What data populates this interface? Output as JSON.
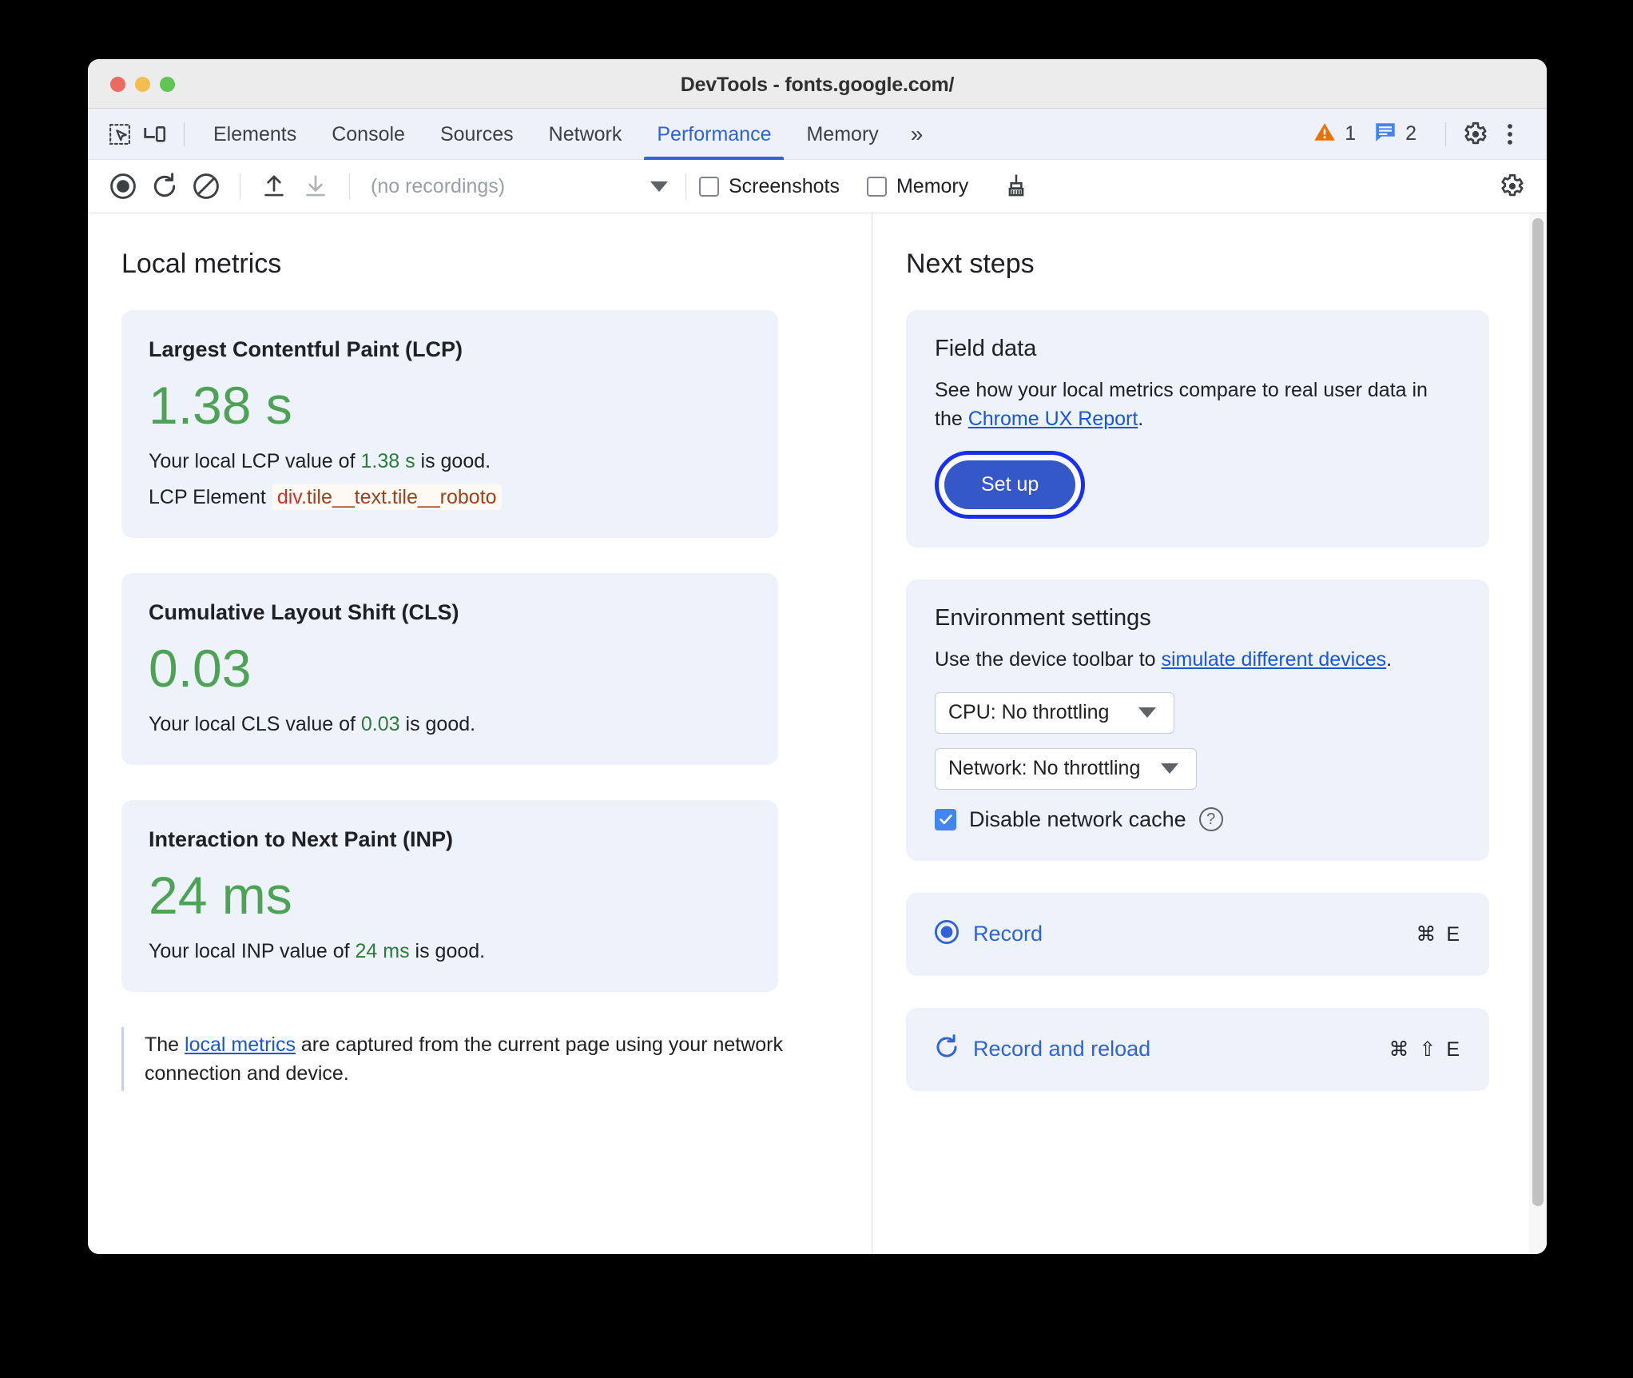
{
  "window": {
    "title": "DevTools - fonts.google.com/",
    "traffic_lights": [
      "close",
      "minimize",
      "maximize"
    ]
  },
  "tabbar": {
    "inspect_icon": "inspect-element-icon",
    "device_icon": "device-toolbar-icon",
    "tabs": [
      {
        "label": "Elements",
        "active": false
      },
      {
        "label": "Console",
        "active": false
      },
      {
        "label": "Sources",
        "active": false
      },
      {
        "label": "Network",
        "active": false
      },
      {
        "label": "Performance",
        "active": true
      },
      {
        "label": "Memory",
        "active": false
      }
    ],
    "overflow_label": "»",
    "warning_count": "1",
    "issue_count": "2",
    "settings_icon": "gear-icon",
    "more_icon": "more-options-icon",
    "accent_color": "#2f63d6"
  },
  "toolbar": {
    "record_icon": "record-icon",
    "reload_icon": "record-and-reload-icon",
    "clear_icon": "clear-icon",
    "upload_icon": "upload-profile-icon",
    "download_icon": "download-profile-icon",
    "recordings_value": "(no recordings)",
    "screenshots_label": "Screenshots",
    "screenshots_checked": false,
    "memory_label": "Memory",
    "memory_checked": false,
    "cleanup_icon": "brush-icon",
    "settings_icon": "capture-settings-gear-icon"
  },
  "left_pane": {
    "title": "Local metrics",
    "metrics": [
      {
        "name": "Largest Contentful Paint (LCP)",
        "value": "1.38 s",
        "desc_prefix": "Your local LCP value of ",
        "desc_value": "1.38 s",
        "desc_suffix": " is good.",
        "element_label": "LCP Element",
        "element_tag": "div",
        "element_classes": ".tile__text.tile__roboto"
      },
      {
        "name": "Cumulative Layout Shift (CLS)",
        "value": "0.03",
        "desc_prefix": "Your local CLS value of ",
        "desc_value": "0.03",
        "desc_suffix": " is good."
      },
      {
        "name": "Interaction to Next Paint (INP)",
        "value": "24 ms",
        "desc_prefix": "Your local INP value of ",
        "desc_value": "24 ms",
        "desc_suffix": " is good."
      }
    ],
    "note_prefix": "The ",
    "note_link": "local metrics",
    "note_suffix": " are captured from the current page using your network connection and device."
  },
  "right_pane": {
    "title": "Next steps",
    "field_data": {
      "title": "Field data",
      "text_prefix": "See how your local metrics compare to real user data in the ",
      "link": "Chrome UX Report",
      "text_suffix": ".",
      "button_label": "Set up",
      "button_color": "#3558c8",
      "focus_ring_color": "#1a2ef0"
    },
    "environment": {
      "title": "Environment settings",
      "text_prefix": "Use the device toolbar to ",
      "link": "simulate different devices",
      "text_suffix": ".",
      "cpu_select": "CPU: No throttling",
      "network_select": "Network: No throttling",
      "cache_label": "Disable network cache",
      "cache_checked": true,
      "help_icon": "help-icon"
    },
    "actions": [
      {
        "label": "Record",
        "shortcut": "⌘ E",
        "icon": "record-icon"
      },
      {
        "label": "Record and reload",
        "shortcut": "⌘ ⇧ E",
        "icon": "record-and-reload-icon"
      }
    ]
  },
  "colors": {
    "good_green": "#4ea256",
    "card_bg": "#eef2fb",
    "link_blue": "#1a56db",
    "accent_blue": "#2f63d6",
    "warning_orange": "#e8710a",
    "issue_blue": "#4285f4",
    "selector_tag_red": "#c5372c",
    "selector_class_brown": "#9c4221"
  }
}
